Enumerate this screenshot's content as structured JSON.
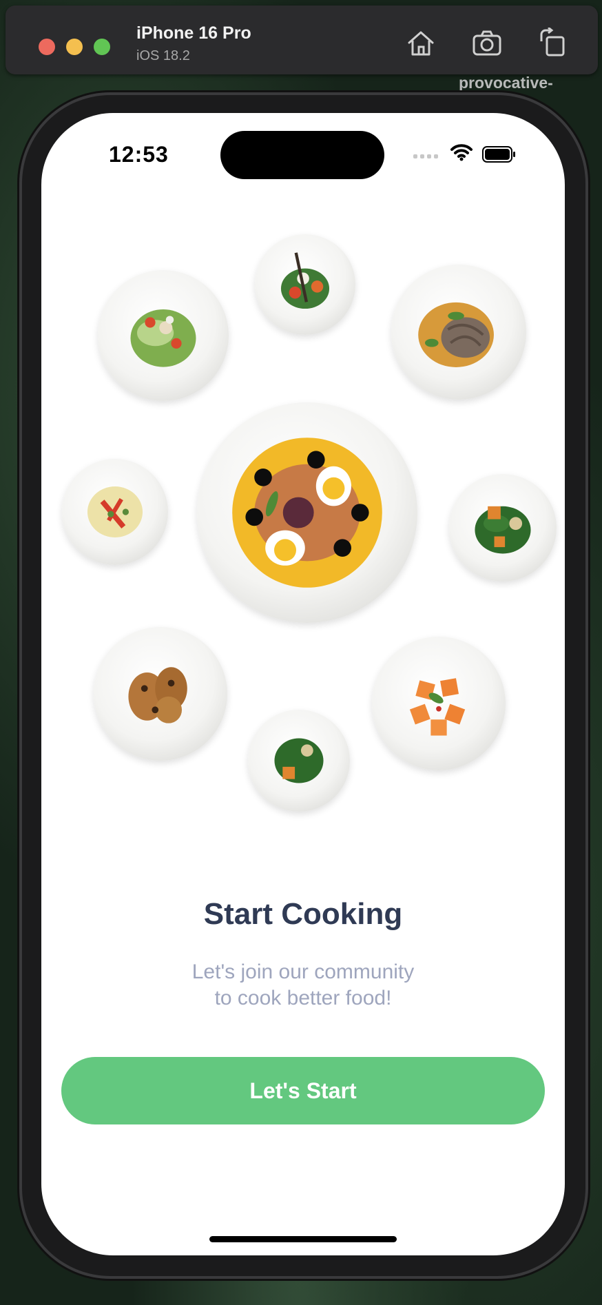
{
  "simulator": {
    "device_name": "iPhone 16 Pro",
    "os_version": "iOS 18.2",
    "background_text": "provocative-\nand",
    "buttons": [
      "home-icon",
      "screenshot-icon",
      "rotate-icon"
    ]
  },
  "status_bar": {
    "time": "12:53"
  },
  "onboarding": {
    "title": "Start Cooking",
    "subtitle_line1": "Let's join our community",
    "subtitle_line2": "to cook better food!",
    "cta_label": "Let's Start"
  },
  "colors": {
    "accent": "#63c87f",
    "title": "#2f3a54",
    "subtitle": "#9ea5bd"
  }
}
